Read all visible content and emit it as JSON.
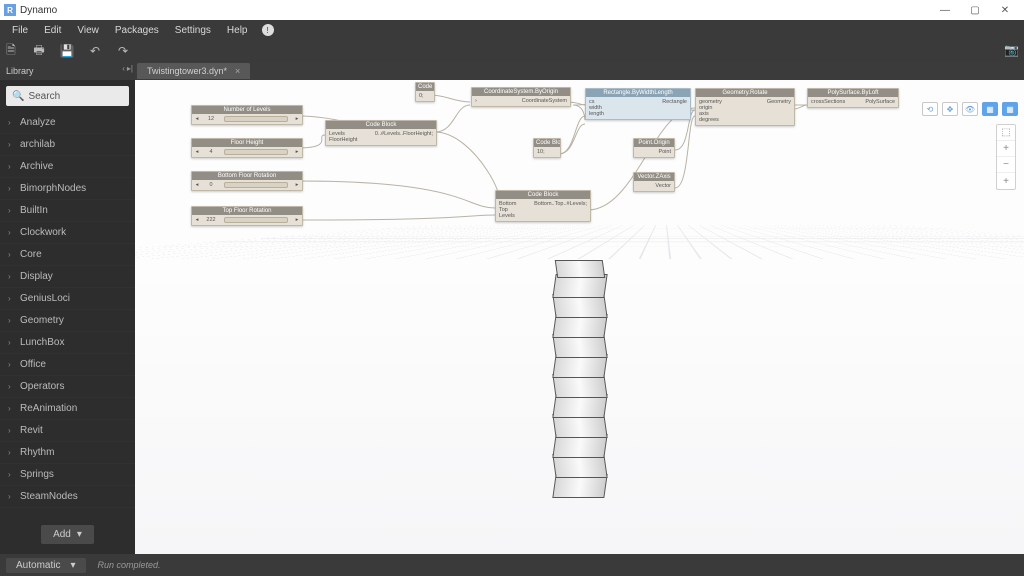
{
  "window": {
    "app_title": "Dynamo",
    "min": "—",
    "max": "▢",
    "close": "✕"
  },
  "menu": [
    "File",
    "Edit",
    "View",
    "Packages",
    "Settings",
    "Help"
  ],
  "menu_info": "!",
  "library": {
    "title": "Library",
    "search_placeholder": "Search",
    "items": [
      "Analyze",
      "archilab",
      "Archive",
      "BimorphNodes",
      "BuiltIn",
      "Clockwork",
      "Core",
      "Display",
      "GeniusLoci",
      "Geometry",
      "LunchBox",
      "Office",
      "Operators",
      "ReAnimation",
      "Revit",
      "Rhythm",
      "Springs",
      "SteamNodes"
    ],
    "add_label": "Add"
  },
  "tab": {
    "name": "Twistingtower3.dyn*",
    "close": "×"
  },
  "nodes": {
    "slider1": {
      "title": "Number of Levels",
      "value": "12"
    },
    "slider2": {
      "title": "Floor Height",
      "value": "4"
    },
    "slider3": {
      "title": "Bottom Floor Rotation",
      "value": "0"
    },
    "slider4": {
      "title": "Top Floor Rotation",
      "value": "222"
    },
    "cb_top": {
      "title": "Code Block",
      "out": "0;"
    },
    "cb_range": {
      "title": "Code Block",
      "in1": "Levels",
      "in2": "FloorHeight",
      "out": "0..#Levels..FloorHeight;"
    },
    "cs": {
      "title": "CoordinateSystem.ByOrigin",
      "out": "CoordinateSystem"
    },
    "rect": {
      "title": "Rectangle.ByWidthLength",
      "p1": "cs",
      "p2": "width",
      "p3": "length",
      "out": "Rectangle"
    },
    "cb_dim": {
      "title": "Code Block",
      "out": "10;"
    },
    "pt": {
      "title": "Point.Origin",
      "out": "Point"
    },
    "vec": {
      "title": "Vector.ZAxis",
      "out": "Vector"
    },
    "cb_rot": {
      "title": "Code Block",
      "p1": "Bottom",
      "p2": "Top",
      "p3": "Levels",
      "out": "Bottom..Top..#Levels;"
    },
    "rotate": {
      "title": "Geometry.Rotate",
      "p1": "geometry",
      "p2": "origin",
      "p3": "axis",
      "p4": "degrees",
      "out": "Geometry"
    },
    "loft": {
      "title": "PolySurface.ByLoft",
      "p1": "crossSections",
      "out": "PolySurface"
    }
  },
  "viewport": {
    "zoom_fit": "⬚",
    "zoom_in": "+",
    "zoom_out": "−",
    "zoom_add": "+"
  },
  "status": {
    "runmode": "Automatic",
    "runmode_chev": "▾",
    "message": "Run completed."
  }
}
